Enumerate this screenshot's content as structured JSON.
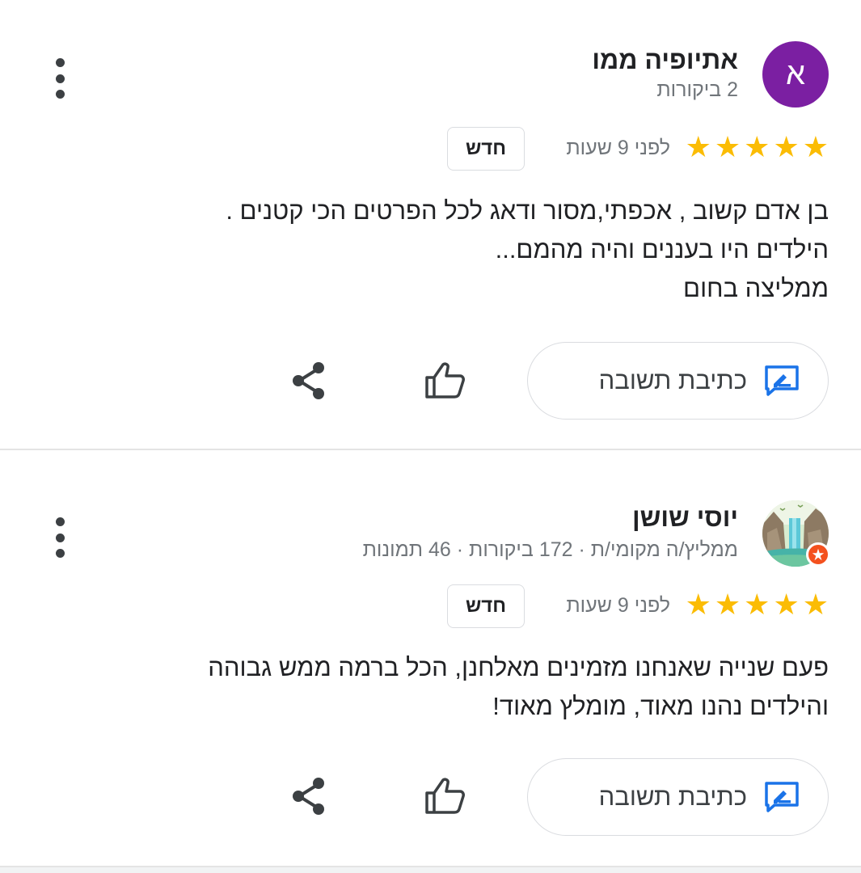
{
  "reviews": [
    {
      "avatar_letter": "א",
      "avatar_color": "#7b1fa2",
      "name": "אתיופיה ממו",
      "meta": "2 ביקורות",
      "rating": 5,
      "time": "לפני 9 שעות",
      "badge": "חדש",
      "text_lines": [
        "בן אדם קשוב , אכפתי,מסור ודאג לכל הפרטים הכי קטנים .",
        "הילדים היו בעננים והיה מהמם...",
        "ממליצה בחום"
      ],
      "reply_label": "כתיבת תשובה",
      "icons": {
        "menu": "more-vertical-icon",
        "reply": "reply-icon",
        "like": "thumbs-up-icon",
        "share": "share-icon"
      }
    },
    {
      "avatar_image": "waterfall-landscape-avatar",
      "local_guide_badge": true,
      "name": "יוסי שושן",
      "meta": "ממליץ/ה מקומי/ת · 172 ביקורות · 46 תמונות",
      "rating": 5,
      "time": "לפני 9 שעות",
      "badge": "חדש",
      "text_lines": [
        "פעם שנייה שאנחנו מזמינים מאלחנן, הכל ברמה ממש גבוהה",
        "והילדים נהנו מאוד, מומלץ מאוד!"
      ],
      "reply_label": "כתיבת תשובה",
      "icons": {
        "menu": "more-vertical-icon",
        "reply": "reply-icon",
        "like": "thumbs-up-icon",
        "share": "share-icon"
      }
    }
  ],
  "colors": {
    "star": "#fbbc04",
    "reply_icon": "#1a73e8",
    "secondary_text": "#70757a",
    "local_guide_badge": "#f4511e"
  }
}
